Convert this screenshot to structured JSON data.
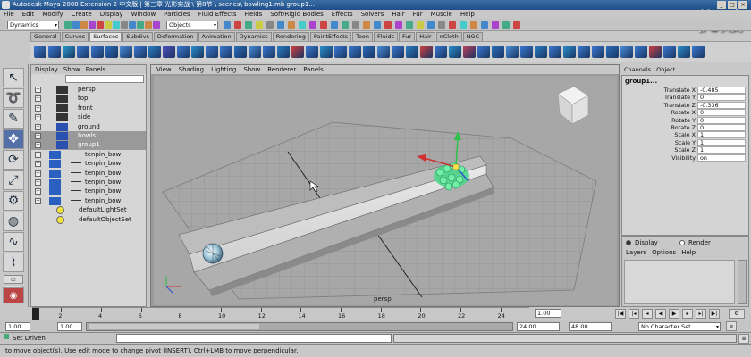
{
  "window": {
    "title": "Autodesk Maya 2008 Extension 2 中文版 | 第三章  光影实战  \\ 第8节 \\ scenes\\ bowling1.mb    group1..."
  },
  "watermark": "优酷",
  "menubar": [
    "File",
    "Edit",
    "Modify",
    "Create",
    "Display",
    "Window",
    "Particles",
    "Fluid Effects",
    "Fields",
    "Soft/Rigid Bodies",
    "Effects",
    "Solvers",
    "Hair",
    "Fur",
    "Muscle",
    "Help"
  ],
  "statusline": {
    "mode": "Dynamics",
    "selection_mask": "Objects"
  },
  "shelf_tabs": [
    "General",
    "Curves",
    "Surfaces",
    "Subdivs",
    "Deformation",
    "Animation",
    "Dynamics",
    "Rendering",
    "PaintEffects",
    "Toon",
    "Fluids",
    "Fur",
    "Hair",
    "nCloth",
    "NGC"
  ],
  "shelf_active": "Surfaces",
  "outliner": {
    "menu": [
      "Display",
      "Show",
      "Panels"
    ],
    "items": [
      {
        "label": "persp",
        "kind": "camera"
      },
      {
        "label": "top",
        "kind": "camera"
      },
      {
        "label": "front",
        "kind": "camera"
      },
      {
        "label": "side",
        "kind": "camera"
      },
      {
        "label": "ground",
        "kind": "mesh"
      },
      {
        "label": "bowls",
        "kind": "mesh"
      },
      {
        "label": "group1",
        "kind": "mesh"
      },
      {
        "label": "tenpin_bow",
        "kind": "sub"
      },
      {
        "label": "tenpin_bow",
        "kind": "sub"
      },
      {
        "label": "tenpin_bow",
        "kind": "sub"
      },
      {
        "label": "tenpin_bow",
        "kind": "sub"
      },
      {
        "label": "tenpin_bow",
        "kind": "sub"
      },
      {
        "label": "tenpin_bow",
        "kind": "sub"
      },
      {
        "label": "defaultLightSet",
        "kind": "set"
      },
      {
        "label": "defaultObjectSet",
        "kind": "set"
      }
    ]
  },
  "viewport": {
    "menu": [
      "View",
      "Shading",
      "Lighting",
      "Show",
      "Renderer",
      "Panels"
    ],
    "camera_label": "persp"
  },
  "channelbox": {
    "menu": [
      "Channels",
      "Object"
    ],
    "node": "group1...",
    "channels": [
      {
        "label": "Translate X",
        "value": "-0.485"
      },
      {
        "label": "Translate Y",
        "value": "0"
      },
      {
        "label": "Translate Z",
        "value": "-0.336"
      },
      {
        "label": "Rotate X",
        "value": "0"
      },
      {
        "label": "Rotate Y",
        "value": "0"
      },
      {
        "label": "Rotate Z",
        "value": "0"
      },
      {
        "label": "Scale X",
        "value": "1"
      },
      {
        "label": "Scale Y",
        "value": "1"
      },
      {
        "label": "Scale Z",
        "value": "1"
      },
      {
        "label": "Visibility",
        "value": "on"
      }
    ]
  },
  "layers": {
    "display_radio": "Display",
    "render_radio": "Render",
    "menu": [
      "Layers",
      "Options",
      "Help"
    ]
  },
  "timeline": {
    "ticks": [
      "2",
      "4",
      "6",
      "8",
      "10",
      "12",
      "14",
      "16",
      "18",
      "20",
      "22",
      "24"
    ],
    "current_frame": "1.00"
  },
  "range": {
    "start": "1.00",
    "playback_start": "1.00",
    "end": "24.00",
    "playback_end": "48.00",
    "character_set": "No Character Set"
  },
  "cmdline": {
    "label": "Set Driven"
  },
  "helpline": {
    "text": "to move object(s). Use edit mode to change pivot (INSERT).  Ctrl+LMB to move perpendicular."
  }
}
